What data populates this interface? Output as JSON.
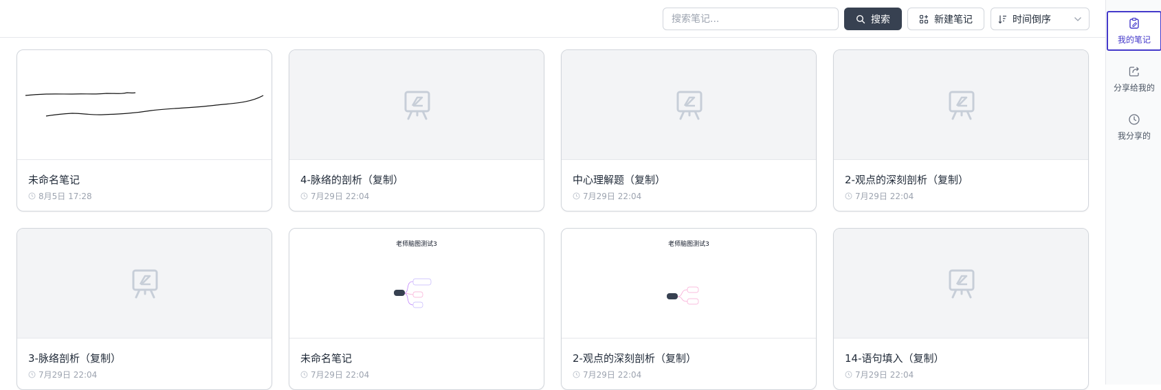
{
  "toolbar": {
    "search_placeholder": "搜索笔记...",
    "search_label": "搜索",
    "new_label": "新建笔记",
    "sort_label": "时间倒序"
  },
  "notes": [
    {
      "title": "未命名笔记",
      "time": "8月5日 17:28",
      "thumb": "sketch"
    },
    {
      "title": "4-脉络的剖析（复制）",
      "time": "7月29日 22:04",
      "thumb": "empty"
    },
    {
      "title": "中心理解题（复制）",
      "time": "7月29日 22:04",
      "thumb": "empty"
    },
    {
      "title": "2-观点的深刻剖析（复制）",
      "time": "7月29日 22:04",
      "thumb": "empty"
    },
    {
      "title": "3-脉络剖析（复制）",
      "time": "7月29日 22:04",
      "thumb": "empty"
    },
    {
      "title": "未命名笔记",
      "time": "7月29日 22:04",
      "thumb": "mindmap",
      "thumb_title": "老师脑图测试3"
    },
    {
      "title": "2-观点的深刻剖析（复制）",
      "time": "7月29日 22:04",
      "thumb": "mindmap",
      "thumb_title": "老师脑图测试3"
    },
    {
      "title": "14-语句填入（复制）",
      "time": "7月29日 22:04",
      "thumb": "empty"
    }
  ],
  "sidebar": {
    "items": [
      {
        "label": "我的笔记",
        "icon": "clipboard-edit-icon",
        "active": true
      },
      {
        "label": "分享给我的",
        "icon": "share-icon",
        "active": false
      },
      {
        "label": "我分享的",
        "icon": "clock-icon",
        "active": false
      }
    ]
  },
  "colors": {
    "accent": "#4338ca",
    "search_button": "#374151",
    "placeholder_icon": "#c7ced8"
  }
}
